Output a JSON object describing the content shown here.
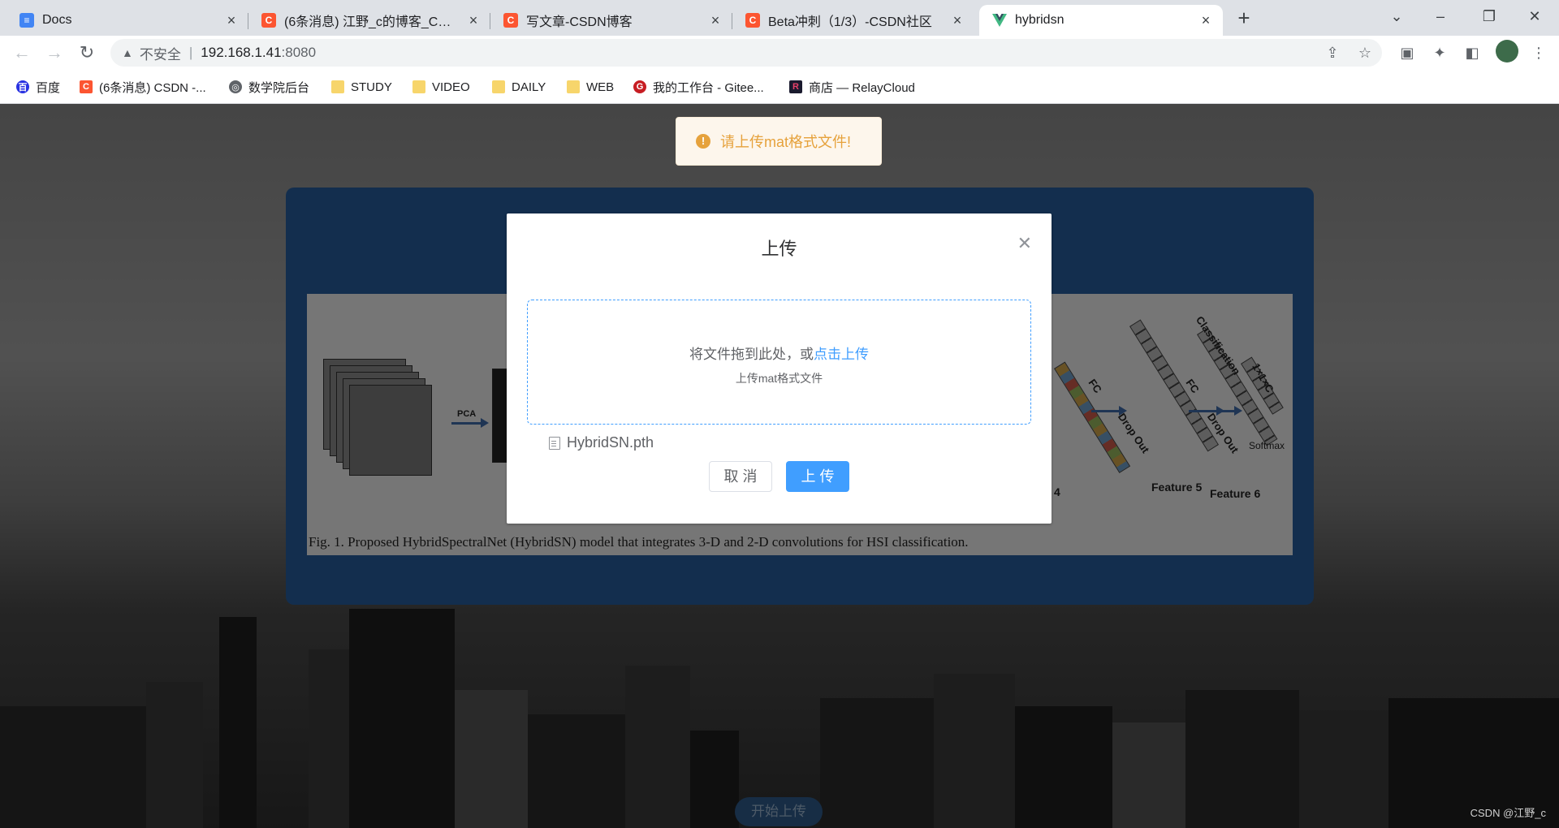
{
  "tabs": [
    {
      "title": "Docs",
      "icon": "docs-icon"
    },
    {
      "title": "(6条消息) 江野_c的博客_CSDN博客",
      "icon": "csdn-icon"
    },
    {
      "title": "写文章-CSDN博客",
      "icon": "csdn-icon"
    },
    {
      "title": "Beta冲刺（1/3）-CSDN社区",
      "icon": "csdn-icon"
    },
    {
      "title": "hybridsn",
      "icon": "vue-icon"
    }
  ],
  "address": {
    "insecure": "不安全",
    "host": "192.168.1.41",
    "port": ":8080"
  },
  "bookmarks": [
    {
      "label": "百度",
      "icon": "baidu-icon"
    },
    {
      "label": "(6条消息) CSDN -...",
      "icon": "csdn-icon"
    },
    {
      "label": "数学院后台",
      "icon": "globe-icon"
    },
    {
      "label": "STUDY",
      "icon": "folder-icon"
    },
    {
      "label": "VIDEO",
      "icon": "folder-icon"
    },
    {
      "label": "DAILY",
      "icon": "folder-icon"
    },
    {
      "label": "WEB",
      "icon": "folder-icon"
    },
    {
      "label": "我的工作台 - Gitee...",
      "icon": "gitee-icon"
    },
    {
      "label": "商店 — RelayCloud",
      "icon": "relaycloud-icon"
    }
  ],
  "toast": {
    "message": "请上传mat格式文件!"
  },
  "figure": {
    "caption": "Fig. 1.   Proposed HybridSpectralNet (HybridSN) model that integrates 3-D and 2-D convolutions for HSI classification.",
    "pca_label": "PCA",
    "fc1": "FC",
    "fc2": "FC",
    "dropout1": "Drop Out",
    "dropout2": "Drop Out",
    "classification": "Classification",
    "output_shape": "1×1×C",
    "softmax": "Softmax",
    "feature4": "4",
    "feature5": "Feature 5",
    "feature6": "Feature 6"
  },
  "dialog": {
    "title": "上传",
    "drop_text": "将文件拖到此处，或",
    "click_text": "点击上传",
    "tip": "上传mat格式文件",
    "file_name": "HybridSN.pth",
    "cancel": "取 消",
    "confirm": "上 传"
  },
  "start_button": "开始上传",
  "watermark": "CSDN @江野_c",
  "colors": {
    "accent": "#409eff",
    "panel": "#275d9c",
    "warning": "#e6a23c"
  }
}
